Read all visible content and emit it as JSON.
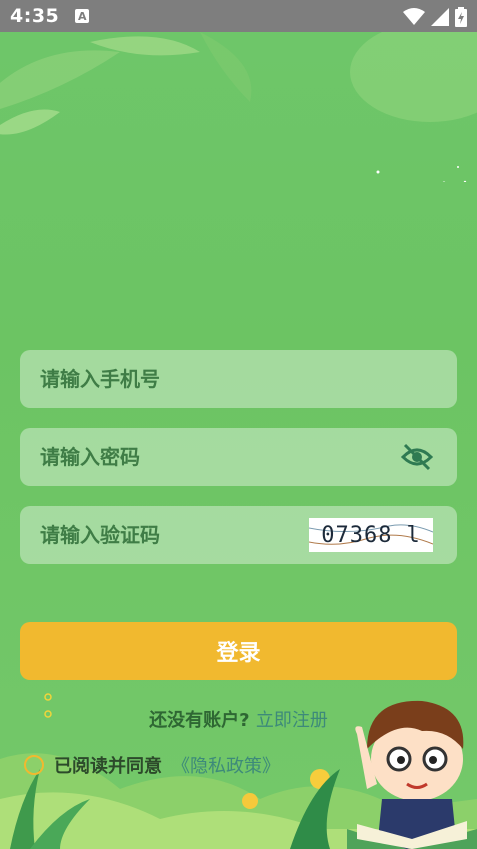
{
  "status_bar": {
    "time": "4:35",
    "app_icon_letter": "A",
    "icons": [
      "wifi-icon",
      "signal-icon",
      "battery-icon"
    ]
  },
  "form": {
    "phone_placeholder": "请输入手机号",
    "password_placeholder": "请输入密码",
    "code_placeholder": "请输入验证码",
    "captcha_text": "07368",
    "captcha_trailing_mark": "l"
  },
  "login_button_label": "登录",
  "register": {
    "prompt": "还没有账户? ",
    "link": "立即注册"
  },
  "agreement": {
    "text": "已阅读并同意",
    "link": "《隐私政策》",
    "checked": false
  },
  "colors": {
    "background": "#6cc463",
    "primary_button": "#f1b92f",
    "link": "#3d8a7a",
    "field_bg": "rgba(255,255,255,0.38)"
  }
}
